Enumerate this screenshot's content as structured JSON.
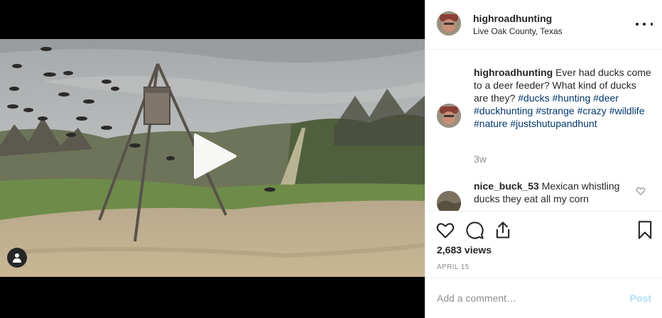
{
  "post": {
    "username": "highroadhunting",
    "location": "Live Oak County, Texas"
  },
  "caption": {
    "username": "highroadhunting",
    "text": "Ever had ducks come to a deer feeder? What kind of ducks are they?",
    "hashtags": [
      "#ducks",
      "#hunting",
      "#deer",
      "#duckhunting",
      "#strange",
      "#crazy",
      "#wildlife",
      "#nature",
      "#justshutupandhunt"
    ],
    "time": "3w"
  },
  "comments": [
    {
      "username": "nice_buck_53",
      "text": "Mexican whistling ducks they eat all my corn"
    }
  ],
  "stats": {
    "views": "2,683 views",
    "date": "APRIL 15"
  },
  "add_comment": {
    "placeholder": "Add a comment…",
    "post_label": "Post"
  },
  "icons": {
    "play": "play-icon",
    "user_tag": "user-tag-icon",
    "more": "more-options-icon",
    "like": "heart-icon",
    "comment": "comment-bubble-icon",
    "share": "share-icon",
    "save": "bookmark-icon"
  },
  "colors": {
    "text": "#262626",
    "muted": "#8e8e8e",
    "hashtag": "#00376b",
    "post_disabled": "#b2dffc",
    "border": "#efefef"
  }
}
